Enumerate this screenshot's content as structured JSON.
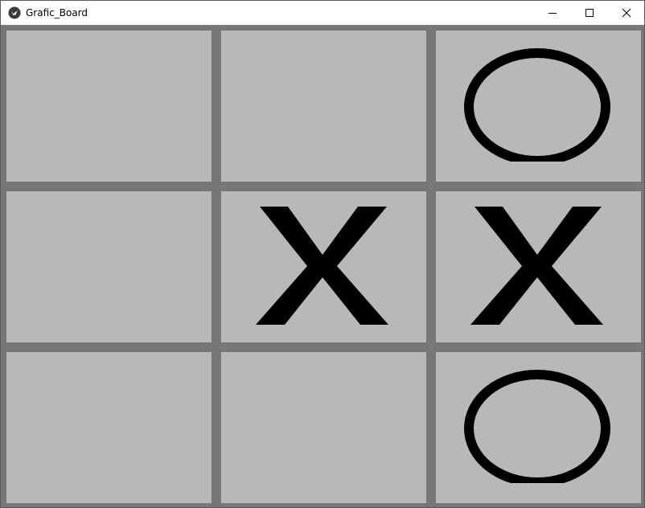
{
  "window": {
    "title": "Grafic_Board",
    "app_icon": "kivy-logo-icon",
    "controls": {
      "minimize": "minimize-icon",
      "maximize": "maximize-icon",
      "close": "close-icon"
    }
  },
  "board": {
    "rows": 3,
    "cols": 3,
    "cells": [
      [
        "",
        "",
        "O"
      ],
      [
        "",
        "X",
        "X"
      ],
      [
        "",
        "",
        "O"
      ]
    ]
  },
  "colors": {
    "board_background": "#777777",
    "cell_background": "#b8b8b8",
    "mark_color": "#000000"
  }
}
